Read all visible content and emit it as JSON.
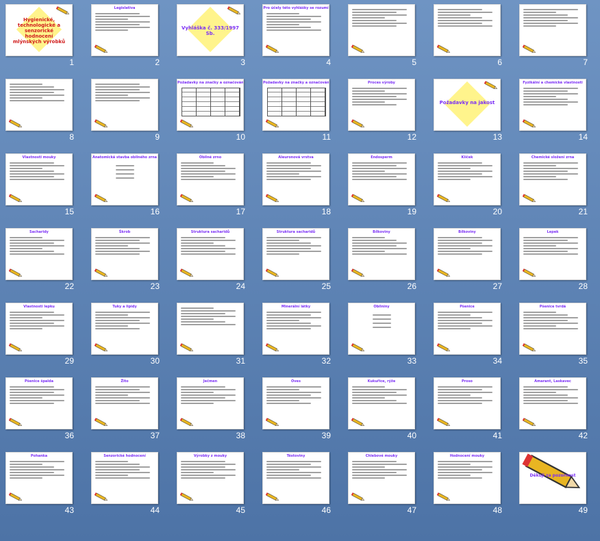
{
  "slides": [
    {
      "n": "1",
      "kind": "title",
      "title": "Hygienické, technologické a senzorické hodnocení mlýnských výrobků"
    },
    {
      "n": "2",
      "kind": "bullets",
      "title": "Legislativa"
    },
    {
      "n": "3",
      "kind": "title2",
      "title": "Vyhláška č. 333/1997 Sb."
    },
    {
      "n": "4",
      "kind": "bullets",
      "title": "Pro účely této vyhlášky se rozumí"
    },
    {
      "n": "5",
      "kind": "bullets",
      "title": ""
    },
    {
      "n": "6",
      "kind": "bullets",
      "title": ""
    },
    {
      "n": "7",
      "kind": "bullets",
      "title": ""
    },
    {
      "n": "8",
      "kind": "bullets",
      "title": ""
    },
    {
      "n": "9",
      "kind": "bullets",
      "title": ""
    },
    {
      "n": "10",
      "kind": "table",
      "title": "Požadavky na značky a označování"
    },
    {
      "n": "11",
      "kind": "table",
      "title": "Požadavky na značky a označování"
    },
    {
      "n": "12",
      "kind": "bullets",
      "title": "Proces výroby"
    },
    {
      "n": "13",
      "kind": "title2",
      "title": "Požadavky na jakost"
    },
    {
      "n": "14",
      "kind": "bullets",
      "title": "Fyzikální a chemické vlastnosti"
    },
    {
      "n": "15",
      "kind": "bullets",
      "title": "Vlastnosti mouky"
    },
    {
      "n": "16",
      "kind": "list",
      "title": "Anatomická stavba obilného zrna"
    },
    {
      "n": "17",
      "kind": "bullets",
      "title": "Obilné zrno"
    },
    {
      "n": "18",
      "kind": "bullets",
      "title": "Aleuronová vrstva"
    },
    {
      "n": "19",
      "kind": "bullets",
      "title": "Endosperm"
    },
    {
      "n": "20",
      "kind": "bullets",
      "title": "Klíček"
    },
    {
      "n": "21",
      "kind": "bullets",
      "title": "Chemické složení zrna"
    },
    {
      "n": "22",
      "kind": "bullets",
      "title": "Sacharidy"
    },
    {
      "n": "23",
      "kind": "bullets",
      "title": "Škrob"
    },
    {
      "n": "24",
      "kind": "bullets",
      "title": "Struktura sacharidů"
    },
    {
      "n": "25",
      "kind": "bullets",
      "title": "Struktura sacharidů"
    },
    {
      "n": "26",
      "kind": "bullets",
      "title": "Bílkoviny"
    },
    {
      "n": "27",
      "kind": "bullets",
      "title": "Bílkoviny"
    },
    {
      "n": "28",
      "kind": "bullets",
      "title": "Lepek"
    },
    {
      "n": "29",
      "kind": "bullets",
      "title": "Vlastnosti lepku"
    },
    {
      "n": "30",
      "kind": "bullets",
      "title": "Tuky a lipidy"
    },
    {
      "n": "31",
      "kind": "bullets",
      "title": ""
    },
    {
      "n": "32",
      "kind": "bullets",
      "title": "Minerální látky"
    },
    {
      "n": "33",
      "kind": "list",
      "title": "Obilniny"
    },
    {
      "n": "34",
      "kind": "bullets",
      "title": "Pšenice"
    },
    {
      "n": "35",
      "kind": "bullets",
      "title": "Pšenice tvrdá"
    },
    {
      "n": "36",
      "kind": "bullets",
      "title": "Pšenice špalda"
    },
    {
      "n": "37",
      "kind": "bullets",
      "title": "Žito"
    },
    {
      "n": "38",
      "kind": "bullets",
      "title": "Ječmen"
    },
    {
      "n": "39",
      "kind": "bullets",
      "title": "Oves"
    },
    {
      "n": "40",
      "kind": "bullets",
      "title": "Kukuřice, rýže"
    },
    {
      "n": "41",
      "kind": "bullets",
      "title": "Proso"
    },
    {
      "n": "42",
      "kind": "bullets",
      "title": "Amarant, Laskavec"
    },
    {
      "n": "43",
      "kind": "bullets",
      "title": "Pohanka"
    },
    {
      "n": "44",
      "kind": "bullets",
      "title": "Senzorické hodnocení"
    },
    {
      "n": "45",
      "kind": "bullets",
      "title": "Výrobky z mouky"
    },
    {
      "n": "46",
      "kind": "bullets",
      "title": "Těstoviny"
    },
    {
      "n": "47",
      "kind": "bullets",
      "title": "Chlebové mouky"
    },
    {
      "n": "48",
      "kind": "bullets",
      "title": "Hodnocení mouky"
    },
    {
      "n": "49",
      "kind": "end",
      "title": "Děkuji za pozornost"
    }
  ]
}
